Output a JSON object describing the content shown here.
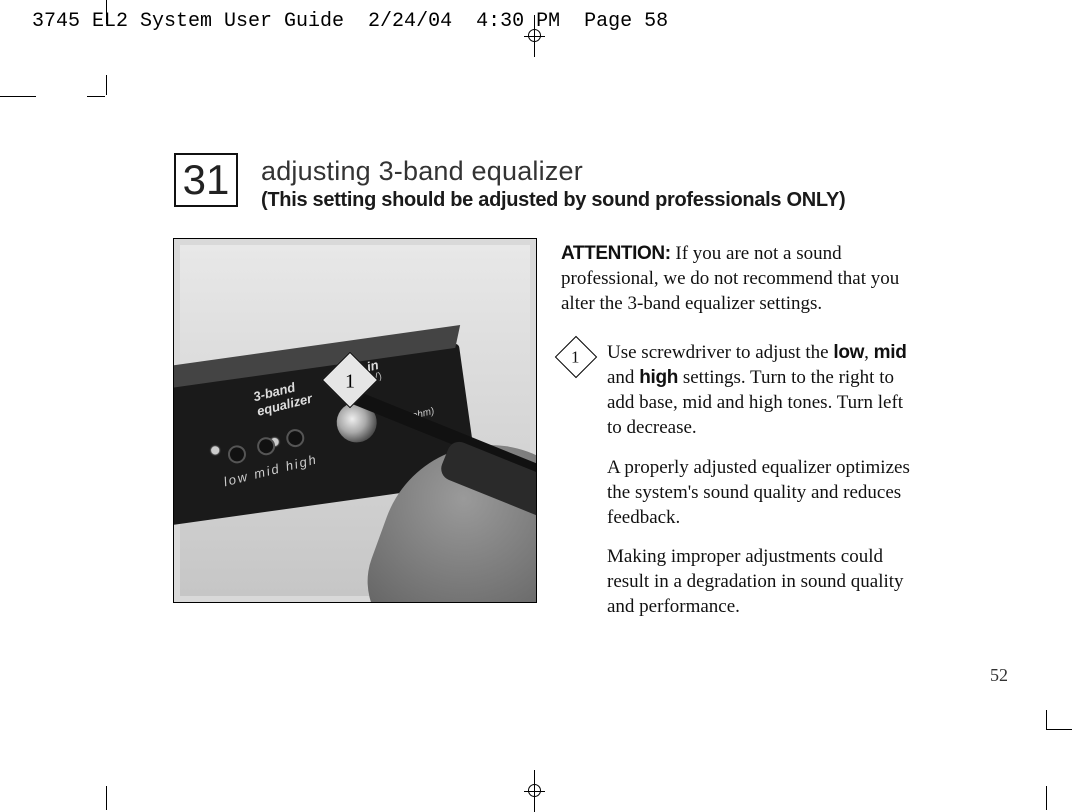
{
  "header": {
    "slug": "3745 EL2 System User Guide  2/24/04  4:30 PM  Page 58"
  },
  "section": {
    "number": "31",
    "title": "adjusting 3-band equalizer",
    "subtitle": "(This setting should be adjusted by sound professionals ONLY)"
  },
  "photo": {
    "callout_number": "1",
    "labels": {
      "band": "3-band",
      "equalizer": "equalizer",
      "auxin": "aux in",
      "auxin_sub": "(CD, TV)",
      "lmh": "low   mid   high",
      "ohm": "(8 ohm)"
    }
  },
  "attention": {
    "label": "ATTENTION:",
    "text": " If you are not a sound professional, we do not recommend that you alter the 3-band equalizer settings."
  },
  "step": {
    "number": "1",
    "pre": "Use screwdriver to adjust the ",
    "bold1": "low",
    "mid": ", ",
    "bold2": "mid",
    "mid2": " and ",
    "bold3": "high",
    "post": " settings. Turn to the right to add base, mid and high tones. Turn left to decrease."
  },
  "paras": {
    "p1": "A properly adjusted equalizer optimizes the system's sound quality and reduces feedback.",
    "p2": "Making improper adjustments could result in a degradation in sound quality and performance."
  },
  "page_number": "52"
}
